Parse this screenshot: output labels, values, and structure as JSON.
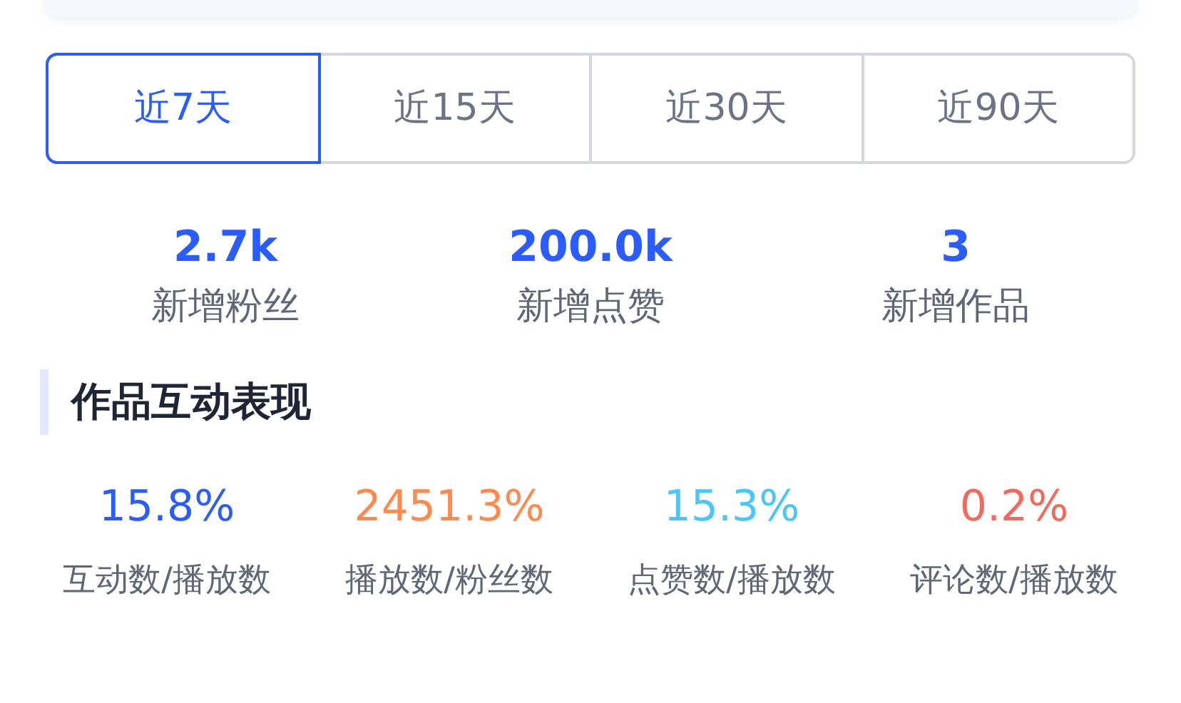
{
  "periods": [
    {
      "label": "近7天",
      "selected": true
    },
    {
      "label": "近15天",
      "selected": false
    },
    {
      "label": "近30天",
      "selected": false
    },
    {
      "label": "近90天",
      "selected": false
    }
  ],
  "summary": [
    {
      "value": "2.7k",
      "label": "新增粉丝"
    },
    {
      "value": "200.0k",
      "label": "新增点赞"
    },
    {
      "value": "3",
      "label": "新增作品"
    }
  ],
  "section_title": "作品互动表现",
  "metrics": [
    {
      "value": "15.8%",
      "label": "互动数/播放数",
      "color": "#2b5cff"
    },
    {
      "value": "2451.3%",
      "label": "播放数/粉丝数",
      "color": "#ff8a4f"
    },
    {
      "value": "15.3%",
      "label": "点赞数/播放数",
      "color": "#4ac6fb"
    },
    {
      "value": "0.2%",
      "label": "评论数/播放数",
      "color": "#f4685d"
    }
  ]
}
